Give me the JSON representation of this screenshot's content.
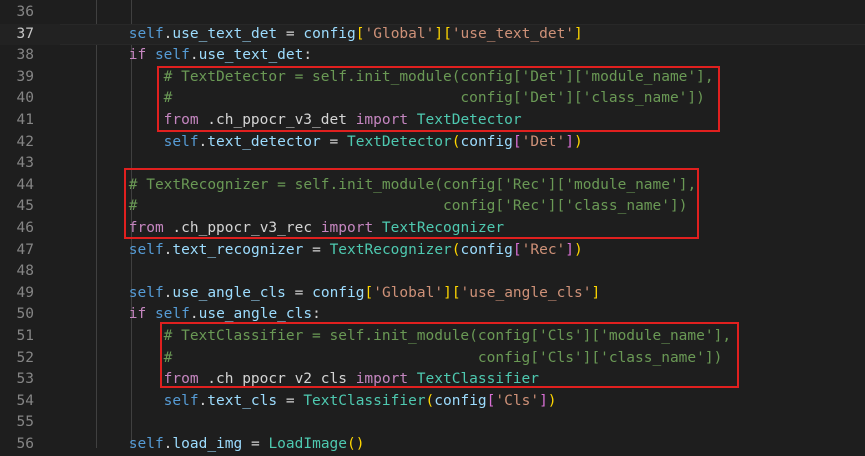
{
  "editor": {
    "lines": [
      {
        "num": "36",
        "indent": 0,
        "tokens": []
      },
      {
        "num": "37",
        "indent": 8,
        "current": true,
        "tokens": [
          [
            "self",
            "self"
          ],
          [
            ".",
            "op"
          ],
          [
            "use_text_det",
            "var"
          ],
          [
            " = ",
            "op"
          ],
          [
            "config",
            "var"
          ],
          [
            "[",
            "br1"
          ],
          [
            "'Global'",
            "str"
          ],
          [
            "]",
            "br1"
          ],
          [
            "[",
            "br1"
          ],
          [
            "'use_text_det'",
            "str"
          ],
          [
            "]",
            "br1"
          ]
        ]
      },
      {
        "num": "38",
        "indent": 8,
        "tokens": [
          [
            "if ",
            "kw"
          ],
          [
            "self",
            "self"
          ],
          [
            ".",
            "op"
          ],
          [
            "use_text_det",
            "var"
          ],
          [
            ":",
            "op"
          ]
        ]
      },
      {
        "num": "39",
        "indent": 12,
        "tokens": [
          [
            "# TextDetector = self.init_module(config['Det']['module_name'],",
            "cmt"
          ]
        ]
      },
      {
        "num": "40",
        "indent": 12,
        "tokens": [
          [
            "#                                 config['Det']['class_name'])",
            "cmt"
          ]
        ]
      },
      {
        "num": "41",
        "indent": 12,
        "tokens": [
          [
            "from ",
            "kw"
          ],
          [
            ".ch_ppocr_v3_det ",
            "op"
          ],
          [
            "import ",
            "kw"
          ],
          [
            "TextDetector",
            "cls"
          ]
        ]
      },
      {
        "num": "42",
        "indent": 12,
        "tokens": [
          [
            "self",
            "self"
          ],
          [
            ".",
            "op"
          ],
          [
            "text_detector",
            "var"
          ],
          [
            " = ",
            "op"
          ],
          [
            "TextDetector",
            "cls"
          ],
          [
            "(",
            "br1"
          ],
          [
            "config",
            "var"
          ],
          [
            "[",
            "br2"
          ],
          [
            "'Det'",
            "str"
          ],
          [
            "]",
            "br2"
          ],
          [
            ")",
            "br1"
          ]
        ]
      },
      {
        "num": "43",
        "indent": 0,
        "tokens": []
      },
      {
        "num": "44",
        "indent": 8,
        "tokens": [
          [
            "# TextRecognizer = self.init_module(config['Rec']['module_name'],",
            "cmt"
          ]
        ]
      },
      {
        "num": "45",
        "indent": 8,
        "tokens": [
          [
            "#                                   config['Rec']['class_name'])",
            "cmt"
          ]
        ]
      },
      {
        "num": "46",
        "indent": 8,
        "tokens": [
          [
            "from ",
            "kw"
          ],
          [
            ".ch_ppocr_v3_rec ",
            "op"
          ],
          [
            "import ",
            "kw"
          ],
          [
            "TextRecognizer",
            "cls"
          ]
        ]
      },
      {
        "num": "47",
        "indent": 8,
        "tokens": [
          [
            "self",
            "self"
          ],
          [
            ".",
            "op"
          ],
          [
            "text_recognizer",
            "var"
          ],
          [
            " = ",
            "op"
          ],
          [
            "TextRecognizer",
            "cls"
          ],
          [
            "(",
            "br1"
          ],
          [
            "config",
            "var"
          ],
          [
            "[",
            "br2"
          ],
          [
            "'Rec'",
            "str"
          ],
          [
            "]",
            "br2"
          ],
          [
            ")",
            "br1"
          ]
        ]
      },
      {
        "num": "48",
        "indent": 0,
        "tokens": []
      },
      {
        "num": "49",
        "indent": 8,
        "tokens": [
          [
            "self",
            "self"
          ],
          [
            ".",
            "op"
          ],
          [
            "use_angle_cls",
            "var"
          ],
          [
            " = ",
            "op"
          ],
          [
            "config",
            "var"
          ],
          [
            "[",
            "br1"
          ],
          [
            "'Global'",
            "str"
          ],
          [
            "]",
            "br1"
          ],
          [
            "[",
            "br1"
          ],
          [
            "'use_angle_cls'",
            "str"
          ],
          [
            "]",
            "br1"
          ]
        ]
      },
      {
        "num": "50",
        "indent": 8,
        "tokens": [
          [
            "if ",
            "kw"
          ],
          [
            "self",
            "self"
          ],
          [
            ".",
            "op"
          ],
          [
            "use_angle_cls",
            "var"
          ],
          [
            ":",
            "op"
          ]
        ]
      },
      {
        "num": "51",
        "indent": 12,
        "tokens": [
          [
            "# TextClassifier = self.init_module(config['Cls']['module_name'],",
            "cmt"
          ]
        ]
      },
      {
        "num": "52",
        "indent": 12,
        "tokens": [
          [
            "#                                   config['Cls']['class_name'])",
            "cmt"
          ]
        ]
      },
      {
        "num": "53",
        "indent": 12,
        "tokens": [
          [
            "from ",
            "kw"
          ],
          [
            ".ch_ppocr_v2_cls ",
            "op"
          ],
          [
            "import ",
            "kw"
          ],
          [
            "TextClassifier",
            "cls"
          ]
        ]
      },
      {
        "num": "54",
        "indent": 12,
        "tokens": [
          [
            "self",
            "self"
          ],
          [
            ".",
            "op"
          ],
          [
            "text_cls",
            "var"
          ],
          [
            " = ",
            "op"
          ],
          [
            "TextClassifier",
            "cls"
          ],
          [
            "(",
            "br1"
          ],
          [
            "config",
            "var"
          ],
          [
            "[",
            "br2"
          ],
          [
            "'Cls'",
            "str"
          ],
          [
            "]",
            "br2"
          ],
          [
            ")",
            "br1"
          ]
        ]
      },
      {
        "num": "55",
        "indent": 0,
        "tokens": []
      },
      {
        "num": "56",
        "indent": 8,
        "tokens": [
          [
            "self",
            "self"
          ],
          [
            ".",
            "op"
          ],
          [
            "load_img",
            "var"
          ],
          [
            " = ",
            "op"
          ],
          [
            "LoadImage",
            "cls"
          ],
          [
            "()",
            "br1"
          ]
        ]
      }
    ]
  },
  "colors": {
    "background": "#1e1e1e",
    "highlight_box": "#e0201f",
    "keyword": "#c586c0",
    "comment": "#6a9955",
    "string": "#ce9178",
    "class": "#4ec9b0"
  }
}
